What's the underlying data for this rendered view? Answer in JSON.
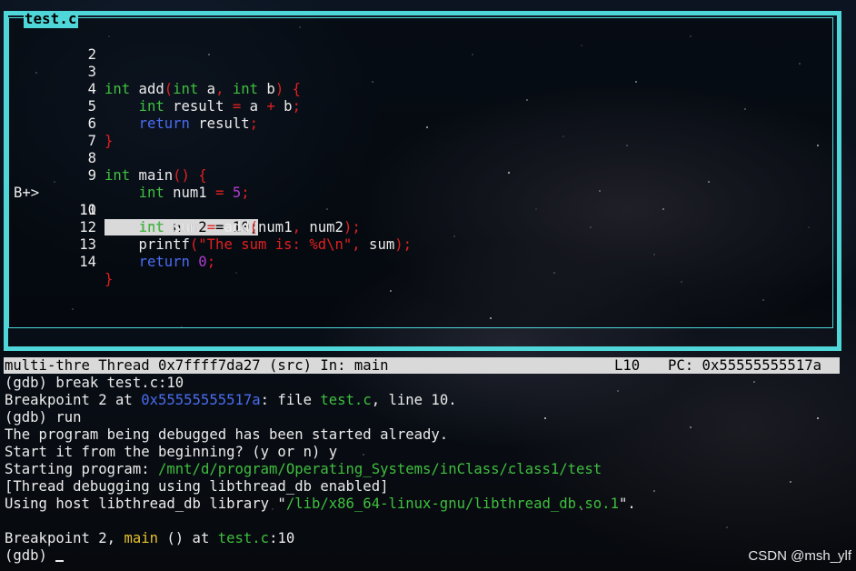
{
  "source_pane": {
    "title": "test.c",
    "lines": [
      {
        "n": "2"
      },
      {
        "n": "3"
      },
      {
        "n": "4"
      },
      {
        "n": "5"
      },
      {
        "n": "6"
      },
      {
        "n": "7"
      },
      {
        "n": "8"
      },
      {
        "n": "9"
      },
      {
        "n": "10",
        "marker": "B+>"
      },
      {
        "n": "11"
      },
      {
        "n": "12"
      },
      {
        "n": "13"
      },
      {
        "n": "14"
      }
    ],
    "code": {
      "l3": {
        "t1": "int",
        "t2": " add",
        "p1": "(",
        "t3": "int",
        "t4": " a",
        "p2": ",",
        "t5": " ",
        "t6": "int",
        "t7": " b",
        "p3": ")",
        "t8": " ",
        "p4": "{"
      },
      "l4": {
        "t1": "    ",
        "t2": "int",
        "t3": " result ",
        "p1": "=",
        "t4": " a ",
        "p2": "+",
        "t5": " b",
        "p3": ";"
      },
      "l5": {
        "t1": "    ",
        "t2": "return",
        "t3": " result",
        "p1": ";"
      },
      "l6": {
        "p1": "}"
      },
      "l8": {
        "t1": "int",
        "t2": " main",
        "p1": "()",
        "t3": " ",
        "p2": "{"
      },
      "l9": {
        "t1": "    ",
        "t2": "int",
        "t3": " num1 ",
        "p1": "=",
        "t4": " ",
        "n1": "5",
        "p2": ";"
      },
      "l10": {
        "t1": "    ",
        "hl": "int num2 = 10;"
      },
      "l11": {
        "t1": "    ",
        "t2": "int",
        "t3": " sum ",
        "p1": "=",
        "t4": " add",
        "p2": "(",
        "t5": "num1",
        "p3": ",",
        "t6": " num2",
        "p4": ");"
      },
      "l12": {
        "t1": "    printf",
        "p1": "(",
        "s1": "\"The sum is: %d\\n\"",
        "p2": ",",
        "t2": " sum",
        "p3": ");"
      },
      "l13": {
        "t1": "    ",
        "t2": "return",
        "t3": " ",
        "n1": "0",
        "p1": ";"
      },
      "l14": {
        "p1": "}"
      }
    }
  },
  "status_bar": {
    "left": "multi-thre Thread 0x7ffff7da27 (src) In: main",
    "line": "L10",
    "pc": "PC: 0x55555555517a"
  },
  "console": {
    "c1": "(gdb) break test.c:10",
    "c2a": "Breakpoint 2 at ",
    "c2b": "0x55555555517a",
    "c2c": ": file ",
    "c2d": "test.c",
    "c2e": ", line 10.",
    "c3": "(gdb) run",
    "c4": "The program being debugged has been started already.",
    "c5": "Start it from the beginning? (y or n) y",
    "c6a": "Starting program: ",
    "c6b": "/mnt/d/program/Operating_Systems/inClass/class1/test",
    "c7": "[Thread debugging using libthread_db enabled]",
    "c8a": "Using host libthread_db library \"",
    "c8b": "/lib/x86_64-linux-gnu/libthread_db.so.1",
    "c8c": "\".",
    "c10a": "Breakpoint 2, ",
    "c10b": "main",
    "c10c": " () at ",
    "c10d": "test.c",
    "c10e": ":10",
    "c11": "(gdb) "
  },
  "watermark": "CSDN @msh_ylf",
  "colors": {
    "frame": "#4fd6d8",
    "type_keyword": "#3fbf3f",
    "flow_keyword": "#4a6cf0",
    "punctuation": "#e02020",
    "number": "#b03bd0",
    "highlight": "#d9d9d9"
  }
}
